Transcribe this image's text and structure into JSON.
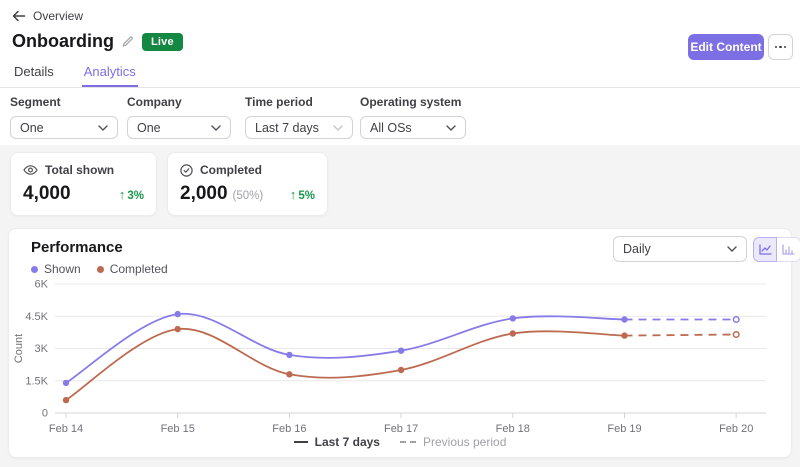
{
  "breadcrumb": {
    "back_label": "Overview"
  },
  "header": {
    "title": "Onboarding",
    "status_badge": "Live",
    "edit_content_label": "Edit Content"
  },
  "tabs": [
    {
      "label": "Details",
      "active": false
    },
    {
      "label": "Analytics",
      "active": true
    }
  ],
  "filters": [
    {
      "label": "Segment",
      "value": "One"
    },
    {
      "label": "Company",
      "value": "One"
    },
    {
      "label": "Time period",
      "value": "Last 7 days"
    },
    {
      "label": "Operating system",
      "value": "All OSs"
    }
  ],
  "stats": [
    {
      "icon": "eye-icon",
      "label": "Total shown",
      "value": "4,000",
      "sub": "",
      "delta": "3%",
      "delta_dir": "up"
    },
    {
      "icon": "check-circle-icon",
      "label": "Completed",
      "value": "2,000",
      "sub": "(50%)",
      "delta": "5%",
      "delta_dir": "up"
    }
  ],
  "performance": {
    "title": "Performance",
    "legend": [
      {
        "label": "Shown",
        "color": "#877be7"
      },
      {
        "label": "Completed",
        "color": "#bd6a50"
      }
    ],
    "interval_select": {
      "value": "Daily"
    },
    "chart_toggle": [
      {
        "name": "line-chart",
        "active": true
      },
      {
        "name": "bar-chart",
        "active": false
      }
    ],
    "footer_legend": [
      {
        "label": "Last 7 days",
        "style": "solid"
      },
      {
        "label": "Previous period",
        "style": "dashed"
      }
    ]
  },
  "chart_data": {
    "type": "line",
    "title": "Performance",
    "x": [
      "Feb 14",
      "Feb 15",
      "Feb 16",
      "Feb 17",
      "Feb 18",
      "Feb 19",
      "Feb 20"
    ],
    "xlabel": "",
    "ylabel": "Count",
    "ylim": [
      0,
      6000
    ],
    "yticks": [
      0,
      1500,
      3000,
      4500,
      6000
    ],
    "ytick_labels": [
      "0",
      "1.5K",
      "3K",
      "4.5K",
      "6K"
    ],
    "grid": true,
    "legend_position": "top-left",
    "series": [
      {
        "name": "Shown",
        "color": "#877be7",
        "solid_values": [
          1400,
          4600,
          2700,
          2900,
          4400,
          4350
        ],
        "dashed_values": [
          4350,
          4350
        ],
        "solid_label": "Last 7 days",
        "dashed_label": "Previous period"
      },
      {
        "name": "Completed",
        "color": "#bd6a50",
        "solid_values": [
          600,
          3900,
          1800,
          2000,
          3700,
          3600
        ],
        "dashed_values": [
          3600,
          3650
        ],
        "solid_label": "Last 7 days",
        "dashed_label": "Previous period"
      }
    ]
  }
}
